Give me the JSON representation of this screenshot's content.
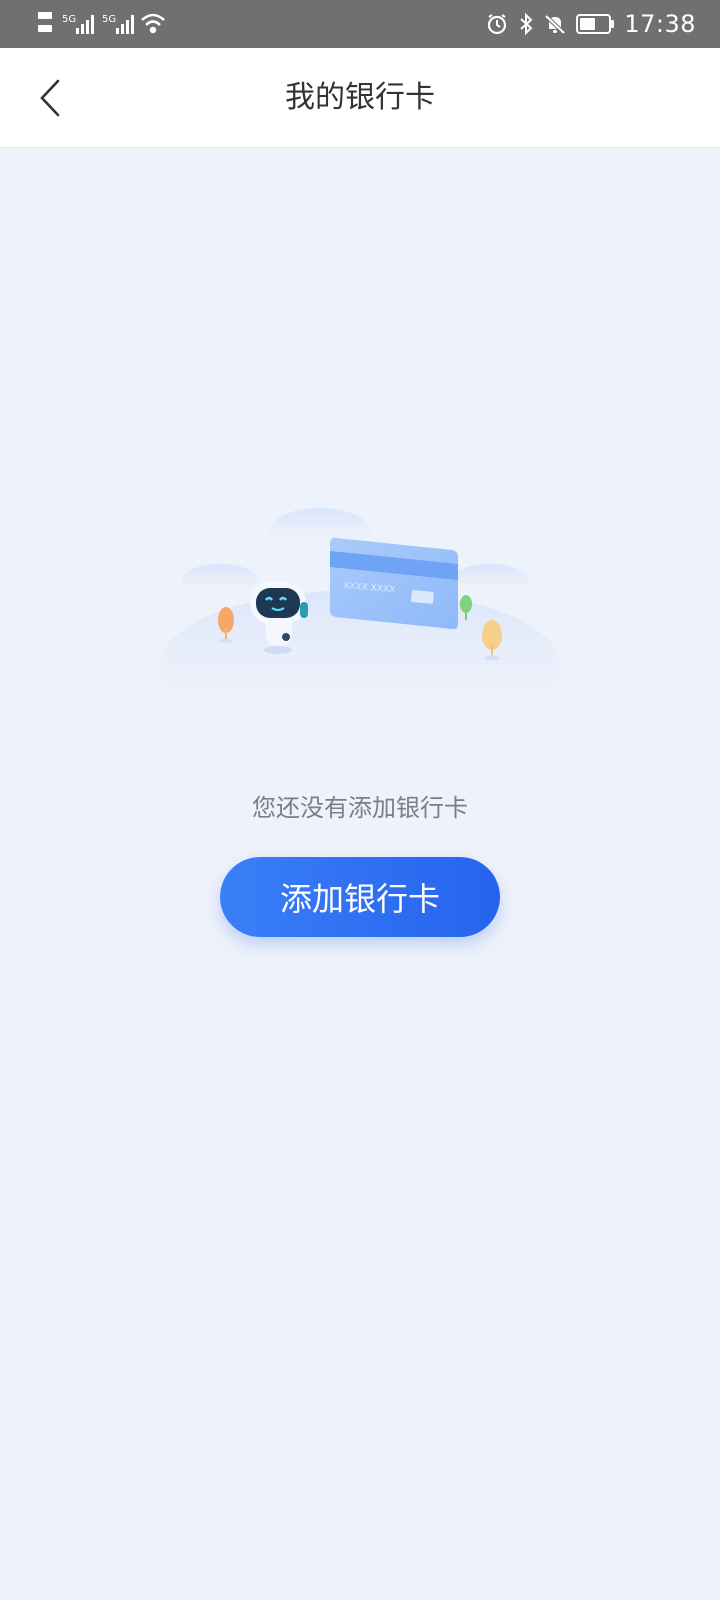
{
  "status_bar": {
    "time": "17:38",
    "network_label": "5G",
    "icons": [
      "hd-icon",
      "signal-icon",
      "wifi-icon",
      "alarm-icon",
      "bluetooth-icon",
      "mute-icon",
      "battery-icon"
    ]
  },
  "header": {
    "back_icon": "chevron-left-icon",
    "title": "我的银行卡"
  },
  "empty_state": {
    "illustration_card_text": "XXXX XXXX",
    "message": "您还没有添加银行卡",
    "button_label": "添加银行卡"
  },
  "colors": {
    "status_bar_bg": "#707070",
    "page_bg": "#eef2fa",
    "accent": "#2e6ef2"
  }
}
